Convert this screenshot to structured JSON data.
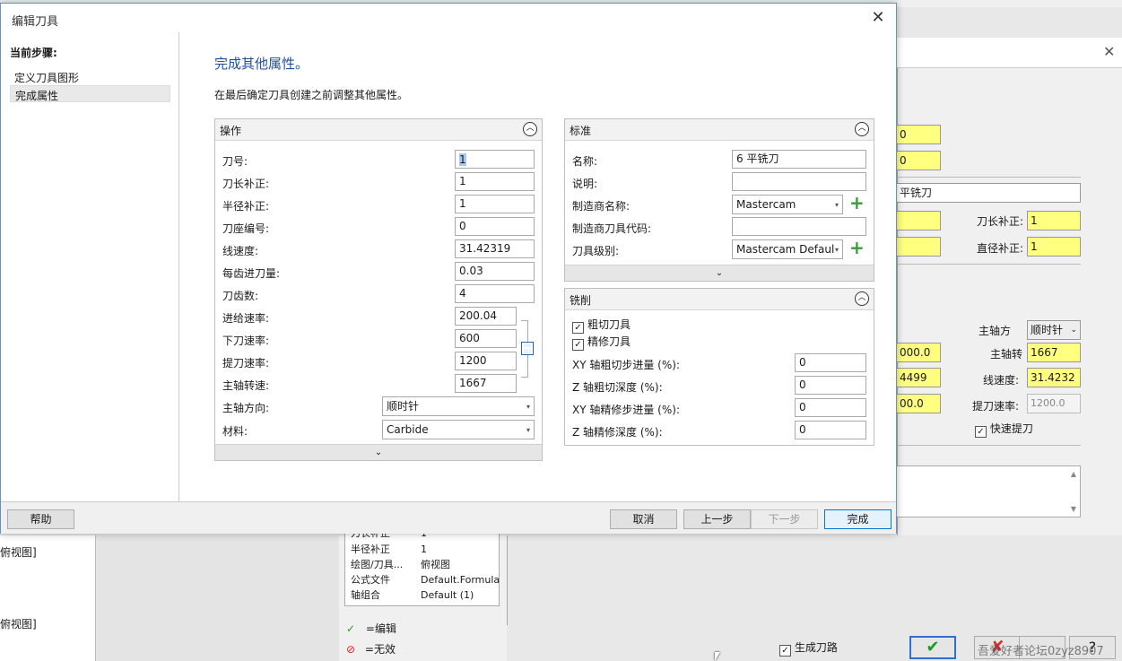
{
  "dialog": {
    "title": "编辑刀具",
    "close_symbol": "✕",
    "steps_title": "当前步骤:",
    "steps": [
      "定义刀具图形",
      "完成属性"
    ],
    "headline": "完成其他属性。",
    "subline": "在最后确定刀具创建之前调整其他属性。"
  },
  "operation_panel": {
    "title": "操作",
    "fields": [
      {
        "label": "刀号:",
        "value": "1"
      },
      {
        "label": "刀长补正:",
        "value": "1"
      },
      {
        "label": "半径补正:",
        "value": "1"
      },
      {
        "label": "刀座编号:",
        "value": "0"
      },
      {
        "label": "线速度:",
        "value": "31.42319"
      },
      {
        "label": "每齿进刀量:",
        "value": "0.03"
      },
      {
        "label": "刀齿数:",
        "value": "4"
      },
      {
        "label": "进给速率:",
        "value": "200.04"
      },
      {
        "label": "下刀速率:",
        "value": "600"
      },
      {
        "label": "提刀速率:",
        "value": "1200"
      },
      {
        "label": "主轴转速:",
        "value": "1667"
      }
    ],
    "spindle_dir": {
      "label": "主轴方向:",
      "value": "顺时针"
    },
    "material": {
      "label": "材料:",
      "value": "Carbide"
    }
  },
  "standard_panel": {
    "title": "标准",
    "name": {
      "label": "名称:",
      "value": "6 平铣刀"
    },
    "desc": {
      "label": "说明:",
      "value": ""
    },
    "maker": {
      "label": "制造商名称:",
      "value": "Mastercam"
    },
    "maker_code": {
      "label": "制造商刀具代码:",
      "value": ""
    },
    "tool_class": {
      "label": "刀具级别:",
      "value": "Mastercam Defaul"
    }
  },
  "milling_panel": {
    "title": "铣削",
    "checks": [
      {
        "label": "粗切刀具",
        "checked": true
      },
      {
        "label": "精修刀具",
        "checked": true
      }
    ],
    "fields": [
      {
        "label": "XY 轴粗切步进量 (%):",
        "value": "0"
      },
      {
        "label": "Z 轴粗切深度 (%):",
        "value": "0"
      },
      {
        "label": "XY 轴精修步进量 (%):",
        "value": "0"
      },
      {
        "label": "Z 轴精修深度 (%):",
        "value": "0"
      }
    ]
  },
  "footer": {
    "help": "帮助",
    "cancel": "取消",
    "prev": "上一步",
    "next": "下一步",
    "finish": "完成"
  },
  "background": {
    "r_y1": "0",
    "r_y2": "0",
    "r_name": "平铣刀",
    "len_comp_label": "刀长补正:",
    "len_comp_value": "1",
    "dia_comp_label": "直径补正:",
    "dia_comp_value": "1",
    "spindle_dir_label": "主轴方",
    "spindle_dir_value": "顺时针",
    "spindle_label": "主轴转",
    "spindle_value": "1667",
    "surf_label": "线速度:",
    "surf_value": "31.4232",
    "retract_label": "提刀速率:",
    "retract_value": "1200.0",
    "fast_retract": "快速提刀",
    "partial1": "000.0",
    "partial2": "4499",
    "partial3": "00.0",
    "left_view1": "俯视图]",
    "left_view2": "俯视图]",
    "props": [
      {
        "k": "刀长补正",
        "v": "1"
      },
      {
        "k": "半径补正",
        "v": "1"
      },
      {
        "k": "绘图/刀具...",
        "v": "俯视图"
      },
      {
        "k": "公式文件",
        "v": "Default.Formula"
      },
      {
        "k": "轴组合",
        "v": "Default (1)"
      }
    ],
    "edit_label": "=编辑",
    "invalid_label": "=无效",
    "gen_path": "生成刀路",
    "watermark": "吾爱好者论坛0zyz8907"
  }
}
